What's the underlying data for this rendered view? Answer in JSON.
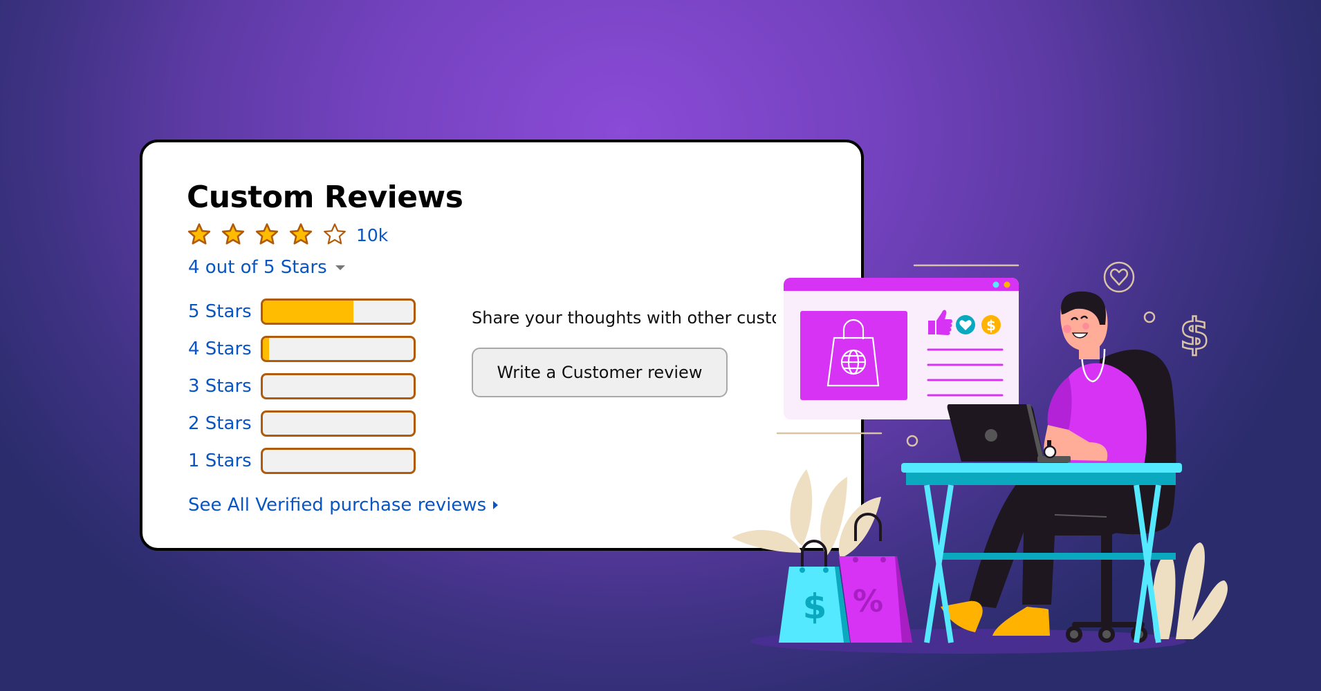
{
  "card": {
    "title": "Custom Reviews",
    "rating": {
      "value": 4,
      "max": 5,
      "count_label": "10k",
      "summary_label": "4 out of 5 Stars",
      "stars": [
        {
          "state": "filled"
        },
        {
          "state": "filled"
        },
        {
          "state": "filled"
        },
        {
          "state": "filled"
        },
        {
          "state": "empty"
        }
      ]
    },
    "distribution": [
      {
        "label": "5 Stars",
        "percent": 60
      },
      {
        "label": "4 Stars",
        "percent": 4
      },
      {
        "label": "3 Stars",
        "percent": 0
      },
      {
        "label": "2 Stars",
        "percent": 0
      },
      {
        "label": "1 Stars",
        "percent": 0
      }
    ],
    "share_text": "Share your thoughts with other customers",
    "write_review_button": "Write a Customer review",
    "see_all_link": "See All Verified purchase reviews"
  },
  "colors": {
    "star_fill": "#ffbc00",
    "star_stroke": "#b05b0c",
    "link": "#0a55c4",
    "bar_fill": "#ffbc00",
    "bar_border": "#b05b0c",
    "accent_magenta": "#d633f5",
    "accent_cyan": "#55e9ff"
  },
  "illustration": {
    "browser_icons": [
      "shopping-bag-globe-icon",
      "thumbs-up-icon",
      "heart-icon",
      "dollar-icon"
    ],
    "floating_icons": [
      "heart-circle-icon",
      "dollar-sign-icon",
      "small-circle-icon"
    ],
    "bags": [
      {
        "symbol": "$"
      },
      {
        "symbol": "%"
      }
    ]
  }
}
